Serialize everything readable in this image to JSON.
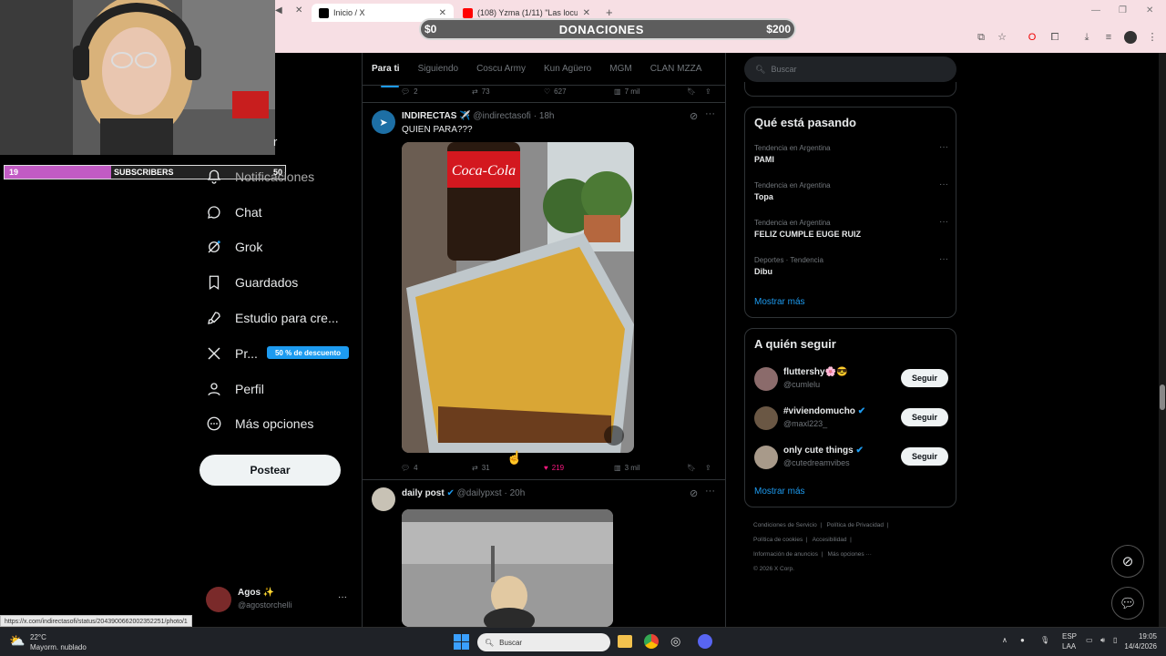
{
  "browser": {
    "tabs": [
      {
        "label": "Inicio / X",
        "active": true
      },
      {
        "label": "(108) Yzma (1/11) \"Las locuras",
        "active": false
      }
    ],
    "status_url": "https://x.com/indirectasofi/status/2043900662002352251/photo/1"
  },
  "donation": {
    "left": "$0",
    "label": "DONACIONES",
    "right": "$200"
  },
  "subs_bar": {
    "current": "19",
    "label": "SUBSCRIBERS",
    "goal": "50",
    "progress_fraction": 0.38
  },
  "nav": {
    "items": [
      {
        "label": "Notificaciones",
        "icon": "bell-icon"
      },
      {
        "label": "Chat",
        "icon": "chat-icon"
      },
      {
        "label": "Grok",
        "icon": "grok-icon"
      },
      {
        "label": "Guardados",
        "icon": "bookmark-icon"
      },
      {
        "label": "Estudio para cre...",
        "icon": "rocket-icon"
      },
      {
        "label": "Pr...",
        "icon": "x-logo-icon"
      },
      {
        "label": "Perfil",
        "icon": "person-icon"
      },
      {
        "label": "Más opciones",
        "icon": "more-circle-icon"
      }
    ],
    "promo_badge": "50 % de descuento",
    "post_label": "Postear",
    "account": {
      "name": "Agos ✨",
      "handle": "@agostorchelli"
    }
  },
  "feed": {
    "tabs": [
      "Para ti",
      "Siguiendo",
      "Coscu Army",
      "Kun Agüero",
      "MGM",
      "CLAN MZZA"
    ],
    "prev_post_stats": {
      "replies": "2",
      "reposts": "73",
      "likes": "627",
      "views": "7 mil"
    },
    "post1": {
      "author": "INDIRECTAS ✈️",
      "handle": "@indirectasofi",
      "time": "18h",
      "text": "QUIEN PARA???",
      "stats": {
        "replies": "4",
        "reposts": "31",
        "likes": "219",
        "views": "3 mil"
      }
    },
    "post2": {
      "author": "daily post",
      "handle": "@dailypxst",
      "time": "20h"
    }
  },
  "sidebar": {
    "search_placeholder": "Buscar",
    "trends_title": "Qué está pasando",
    "trends": [
      {
        "meta": "Tendencia en Argentina",
        "name": "PAMI"
      },
      {
        "meta": "Tendencia en Argentina",
        "name": "Topa"
      },
      {
        "meta": "Tendencia en Argentina",
        "name": "FELIZ CUMPLE EUGE RUIZ"
      },
      {
        "meta": "Deportes · Tendencia",
        "name": "Dibu"
      }
    ],
    "show_more": "Mostrar más",
    "who_to_follow_title": "A quién seguir",
    "suggestions": [
      {
        "name": "fluttershy🌸😎",
        "handle": "@cumlelu",
        "verified": false
      },
      {
        "name": "#viviendomucho",
        "handle": "@maxl223_",
        "verified": true
      },
      {
        "name": "only cute things",
        "handle": "@cutedreamvibes",
        "verified": true
      }
    ],
    "follow_label": "Seguir",
    "footer": [
      "Condiciones de Servicio",
      "Política de Privacidad",
      "Política de cookies",
      "Accesibilidad",
      "Información de anuncios",
      "Más opciones ···",
      "© 2026 X Corp."
    ]
  },
  "taskbar": {
    "weather_temp": "22°C",
    "weather_desc": "Mayorm. nublado",
    "search_placeholder": "Buscar",
    "lang": "ESP",
    "lang2": "LAA",
    "time": "19:05",
    "date": "14/4/2026"
  },
  "colors": {
    "accent": "#1d9bf0",
    "like": "#f91880",
    "browser_bar": "#f7dfe4"
  }
}
